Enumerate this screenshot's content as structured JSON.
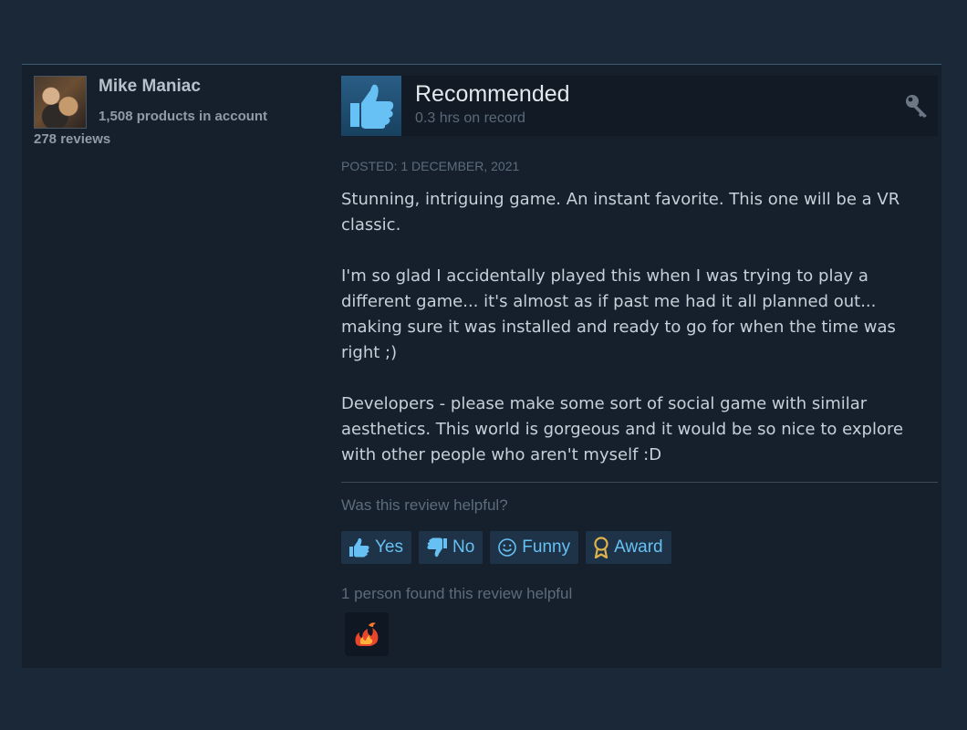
{
  "author": {
    "name": "Mike Maniac",
    "products": "1,508 products in account",
    "reviews": "278 reviews"
  },
  "review": {
    "verdict": "Recommended",
    "hours": "0.3 hrs on record",
    "posted": "Posted: 1 December, 2021",
    "paragraphs": [
      "Stunning, intriguing game. An instant favorite. This one will be a VR classic.",
      "I'm so glad I accidentally played this when I was trying to play a different game... it's almost as if past me had it all planned out... making sure it was installed and ready to go for when the time was right ;)",
      "Developers - please make some sort of social game with similar aesthetics. This world is gorgeous and it would be so nice to explore with other people who aren't myself :D"
    ]
  },
  "feedback": {
    "question": "Was this review helpful?",
    "yes_label": "Yes",
    "no_label": "No",
    "funny_label": "Funny",
    "award_label": "Award",
    "helpful_count": "1 person found this review helpful"
  },
  "icons": {
    "verdict": "thumbs-up-icon",
    "product_activation": "key-icon",
    "yes": "thumbs-up-icon",
    "no": "thumbs-down-icon",
    "funny": "smiley-icon",
    "award": "award-ribbon-icon",
    "received_award": "fire-award-icon"
  },
  "colors": {
    "background": "#1b2838",
    "card": "#16202d",
    "accent": "#66c0f4",
    "thumb_up": "#67c1f5"
  }
}
